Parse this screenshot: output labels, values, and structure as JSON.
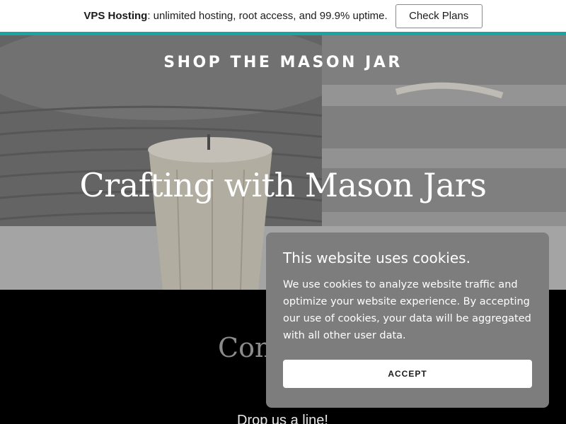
{
  "promo": {
    "brand": "VPS Hosting",
    "text": ": unlimited hosting, root access, and 99.9% uptime.",
    "button_label": "Check Plans"
  },
  "hero": {
    "site_title": "SHOP THE MASON JAR",
    "heading": "Crafting with Mason Jars"
  },
  "contact": {
    "heading_partial": "Con",
    "subheading_partial": "Drop us a line!"
  },
  "cookie_banner": {
    "title": "This website uses cookies.",
    "body": "We use cookies to analyze website traffic and optimize your website experience. By accepting our use of cookies, your data will be aggregated with all other user data.",
    "accept_label": "ACCEPT"
  },
  "colors": {
    "accent_line": "#1aa6a0",
    "cookie_background": "#7d7d7d",
    "page_background": "#000000"
  }
}
